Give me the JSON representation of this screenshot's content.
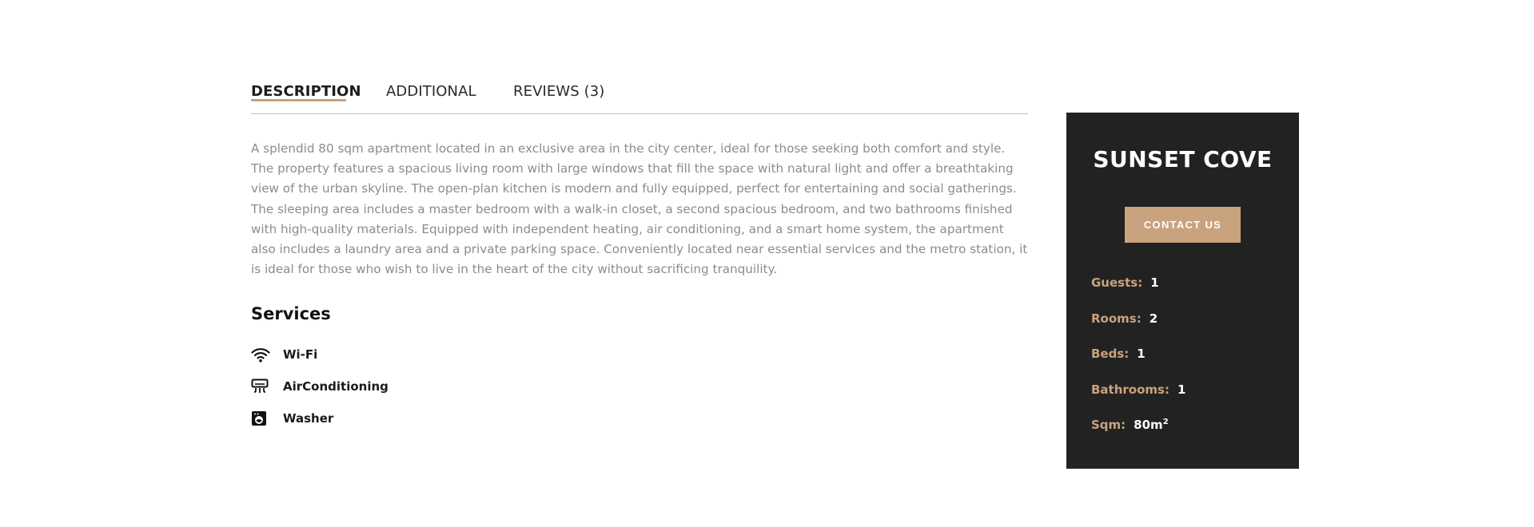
{
  "tabs": [
    {
      "label": "DESCRIPTION",
      "active": true
    },
    {
      "label": "ADDITIONAL",
      "active": false
    },
    {
      "label": "REVIEWS (3)",
      "active": false
    }
  ],
  "description": "A splendid 80 sqm apartment located in an exclusive area in the city center, ideal for those seeking both comfort and style. The property features a spacious living room with large windows that fill the space with natural light and offer a breathtaking view of the urban skyline. The open-plan kitchen is modern and fully equipped, perfect for entertaining and social gatherings. The sleeping area includes a master bedroom with a walk-in closet, a second spacious bedroom, and two bathrooms finished with high-quality materials. Equipped with independent heating, air conditioning, and a smart home system, the apartment also includes a laundry area and a private parking space. Conveniently located near essential services and the metro station, it is ideal for those who wish to live in the heart of the city without sacrificing tranquility.",
  "services": {
    "title": "Services",
    "items": [
      {
        "label": "Wi-Fi",
        "icon": "wifi-icon"
      },
      {
        "label": "AirConditioning",
        "icon": "air-conditioner-icon"
      },
      {
        "label": "Washer",
        "icon": "washer-icon"
      }
    ]
  },
  "sidebar": {
    "title": "SUNSET COVE",
    "contact_label": "CONTACT US",
    "facts": [
      {
        "label": "Guests:",
        "value": "1"
      },
      {
        "label": "Rooms:",
        "value": "2"
      },
      {
        "label": "Beds:",
        "value": "1"
      },
      {
        "label": "Bathrooms:",
        "value": "1"
      },
      {
        "label": "Sqm:",
        "value": "80m",
        "sup": "2"
      }
    ]
  },
  "colors": {
    "accent": "#c9a27e",
    "sidebar_bg": "#222222",
    "description_text": "#8c8c8c"
  }
}
